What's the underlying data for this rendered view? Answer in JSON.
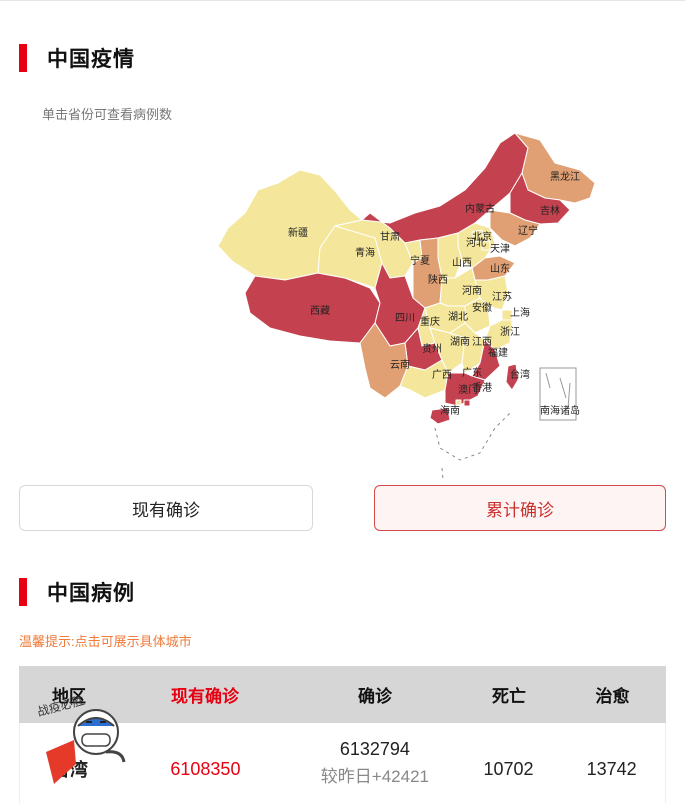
{
  "section1": {
    "title": "中国疫情",
    "hint": "单击省份可查看病例数"
  },
  "map": {
    "colors": {
      "high": "#c4424f",
      "mid": "#e0a074",
      "low": "#f4e79c",
      "border": "#ffffff"
    },
    "provinces": [
      {
        "name": "新疆",
        "level": "low"
      },
      {
        "name": "西藏",
        "level": "high"
      },
      {
        "name": "青海",
        "level": "low"
      },
      {
        "name": "甘肃",
        "level": "low"
      },
      {
        "name": "内蒙古",
        "level": "high"
      },
      {
        "name": "黑龙江",
        "level": "mid"
      },
      {
        "name": "吉林",
        "level": "high"
      },
      {
        "name": "辽宁",
        "level": "mid"
      },
      {
        "name": "北京",
        "level": "low"
      },
      {
        "name": "天津",
        "level": "low"
      },
      {
        "name": "河北",
        "level": "low"
      },
      {
        "name": "山西",
        "level": "low"
      },
      {
        "name": "宁夏",
        "level": "low"
      },
      {
        "name": "陕西",
        "level": "mid"
      },
      {
        "name": "河南",
        "level": "low"
      },
      {
        "name": "山东",
        "level": "mid"
      },
      {
        "name": "江苏",
        "level": "low"
      },
      {
        "name": "安徽",
        "level": "low"
      },
      {
        "name": "湖北",
        "level": "low"
      },
      {
        "name": "上海",
        "level": "low"
      },
      {
        "name": "浙江",
        "level": "low"
      },
      {
        "name": "四川",
        "level": "high"
      },
      {
        "name": "重庆",
        "level": "low"
      },
      {
        "name": "贵州",
        "level": "high"
      },
      {
        "name": "湖南",
        "level": "low"
      },
      {
        "name": "江西",
        "level": "low"
      },
      {
        "name": "福建",
        "level": "high"
      },
      {
        "name": "云南",
        "level": "mid"
      },
      {
        "name": "广西",
        "level": "low"
      },
      {
        "name": "广东",
        "level": "high"
      },
      {
        "name": "台湾",
        "level": "high"
      },
      {
        "name": "香港",
        "level": "high"
      },
      {
        "name": "澳门",
        "level": "low"
      },
      {
        "name": "海南",
        "level": "high"
      },
      {
        "name": "南海诸岛",
        "level": "none"
      }
    ]
  },
  "toggle": {
    "current_label": "现有确诊",
    "total_label": "累计确诊",
    "active": "total"
  },
  "section2": {
    "title": "中国病例",
    "tip": "温馨提示:点击可展示具体城市"
  },
  "table": {
    "headers": [
      "地区",
      "现有确诊",
      "确诊",
      "死亡",
      "治愈"
    ],
    "rows": [
      {
        "region": "台湾",
        "current": "6108350",
        "confirmed": "6132794",
        "confirmed_delta": "较昨日+42421",
        "deaths": "10702",
        "cured": "13742"
      }
    ]
  },
  "sticker": {
    "text": "战疫必胜"
  }
}
